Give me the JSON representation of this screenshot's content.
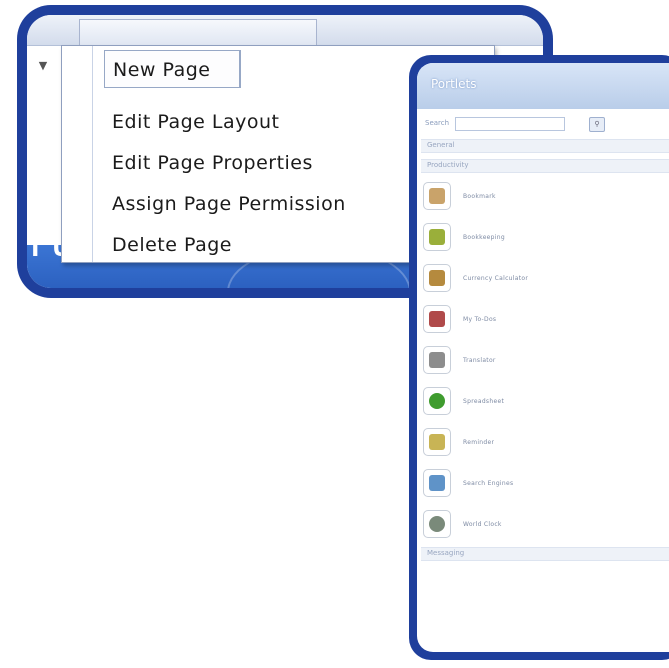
{
  "menu": {
    "items": [
      {
        "label": "New Page"
      },
      {
        "label": "Edit Page Layout"
      },
      {
        "label": "Edit Page Properties"
      },
      {
        "label": "Assign Page Permission"
      },
      {
        "label": "Delete Page"
      }
    ]
  },
  "background_heading": "rted",
  "portlets_panel": {
    "title": "Portlets",
    "search_label": "Search",
    "sections": [
      "General",
      "Productivity",
      "Messaging"
    ],
    "items": [
      {
        "label": "Bookmark",
        "icon": "bookmark-icon",
        "color": "#c9a36a"
      },
      {
        "label": "Bookkeeping",
        "icon": "money-icon",
        "color": "#9aaf3a"
      },
      {
        "label": "Currency Calculator",
        "icon": "calculator-icon",
        "color": "#b58a3e"
      },
      {
        "label": "My To-Dos",
        "icon": "checklist-icon",
        "color": "#b04a4a"
      },
      {
        "label": "Translator",
        "icon": "translator-icon",
        "color": "#8d8d8d"
      },
      {
        "label": "Spreadsheet",
        "icon": "refresh-icon",
        "color": "#3f9c2e"
      },
      {
        "label": "Reminder",
        "icon": "note-icon",
        "color": "#c8b455"
      },
      {
        "label": "Search Engines",
        "icon": "search-engine-icon",
        "color": "#5f93c8"
      },
      {
        "label": "World Clock",
        "icon": "clock-icon",
        "color": "#7a8a7a"
      }
    ]
  }
}
